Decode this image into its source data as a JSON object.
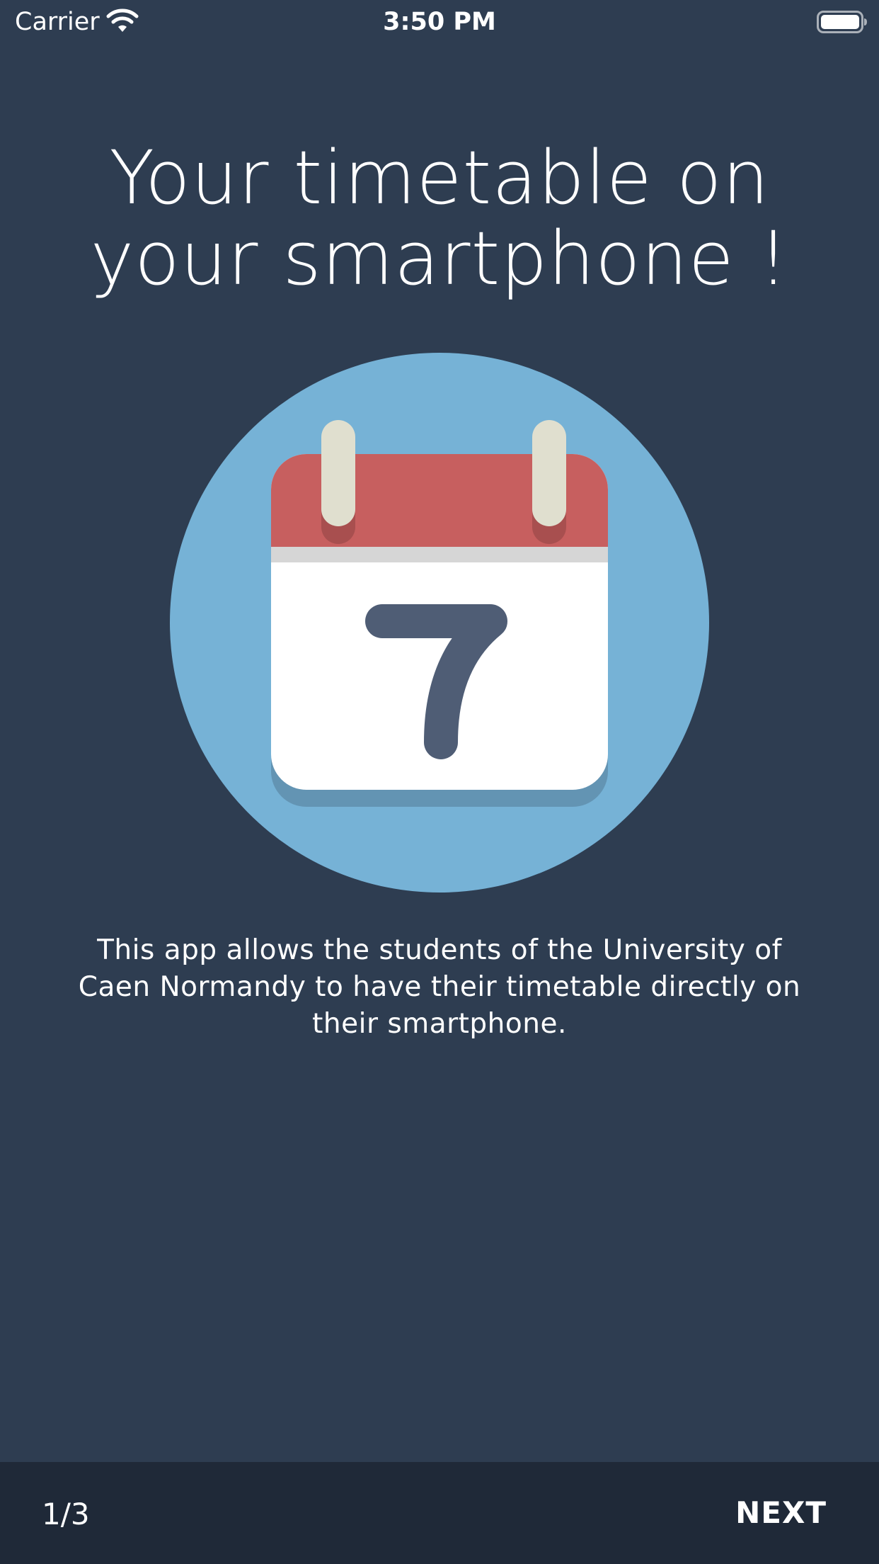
{
  "status_bar": {
    "carrier": "Carrier",
    "time": "3:50 PM",
    "wifi_icon": "wifi-icon",
    "battery_icon": "battery-icon"
  },
  "onboarding": {
    "title_line1": "Your timetable on",
    "title_line2": "your smartphone !",
    "illustration_icon": "calendar-icon",
    "calendar_day": "7",
    "description": "This app allows the students of the University of Caen Normandy to have their timetable directly on their smartphone."
  },
  "footer": {
    "page_indicator": "1/3",
    "next_label": "NEXT"
  },
  "colors": {
    "background": "#2e3d51",
    "footer_background": "#1f2938",
    "circle": "#76b2d6",
    "calendar_header": "#c75f5f",
    "calendar_rings": "#e0dfcf",
    "calendar_digit": "#4f5d75"
  }
}
